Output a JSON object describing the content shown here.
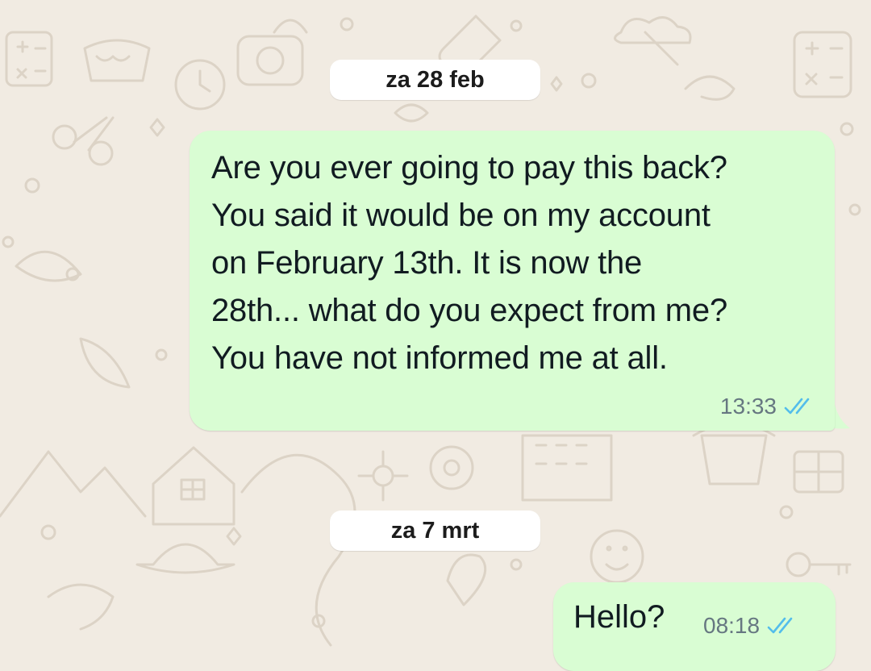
{
  "colors": {
    "wallpaper_bg": "#f1ebe2",
    "doodle_stroke": "#dcd3c6",
    "outgoing_bubble": "#d9fdd3",
    "date_pill": "#ffffff",
    "read_ticks": "#53bdeb",
    "meta_text": "#667781"
  },
  "chat": {
    "date_separators": [
      "za 28 feb",
      "za 7 mrt"
    ],
    "messages": [
      {
        "direction": "outgoing",
        "text": "Are you ever going to pay this back?\nYou said it would be on my account\non February 13th. It is now the\n28th... what do you expect from me?\nYou have not informed me at all.",
        "time": "13:33",
        "status_icon": "double-check-read-icon"
      },
      {
        "direction": "outgoing",
        "text": "Hello?",
        "time": "08:18",
        "status_icon": "double-check-read-icon"
      }
    ]
  }
}
